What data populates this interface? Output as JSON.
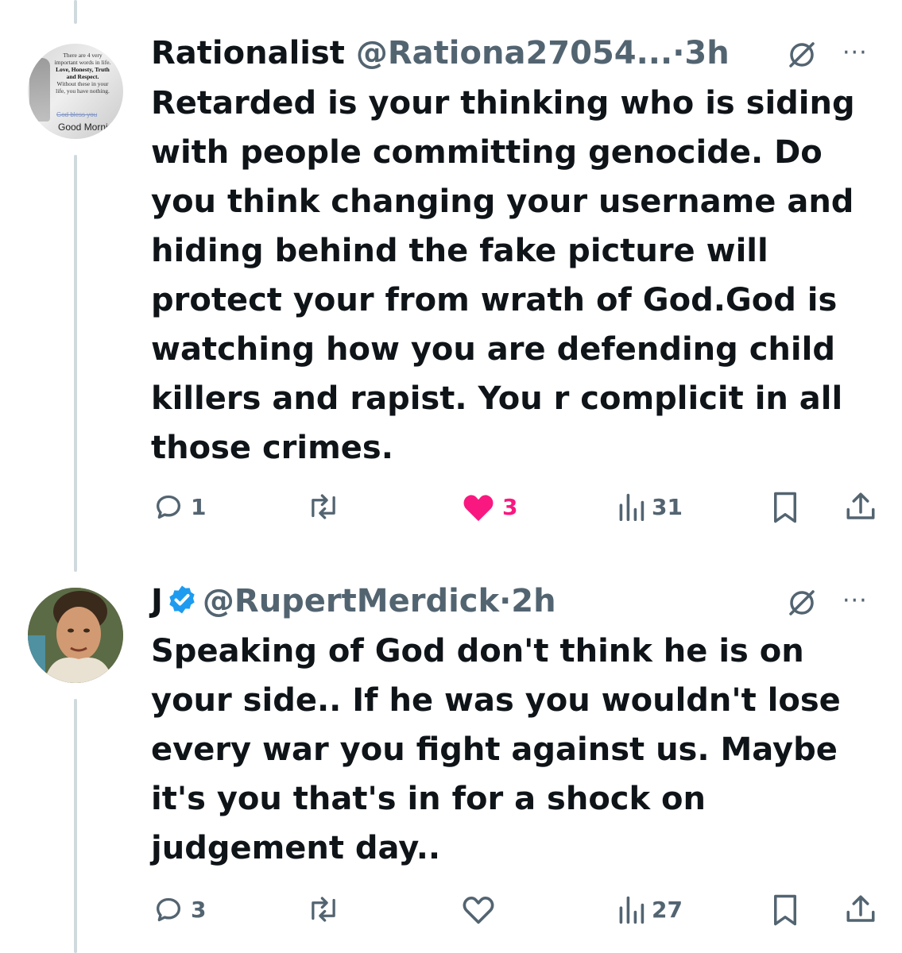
{
  "tweets": [
    {
      "display_name": "Rationalist",
      "handle": "@Rationa27054...",
      "time": "3h",
      "avatar_text": {
        "quote_line1": "There are 4 very",
        "quote_line2": "important words in life.",
        "quote_line3": "Love, Honesty, Truth",
        "quote_line4": "and Respect.",
        "quote_line5": "Without these in your",
        "quote_line6": "life, you have nothing.",
        "god_bless": "God bless you",
        "greeting": "Good Mornir"
      },
      "text": "Retarded is your thinking who is siding with people committing genocide. Do you think changing your username and hiding behind the fake picture will protect your from wrath of God.God is watching how you are defending child killers and rapist. You r complicit in all those crimes.",
      "replies": "1",
      "reposts": "",
      "likes": "3",
      "liked": true,
      "views": "31"
    },
    {
      "display_name": "J",
      "handle": "@RupertMerdick",
      "time": "2h",
      "verified": true,
      "text": "Speaking of God don't think he is on your side.. If he was you wouldn't lose every war you fight against us. Maybe it's you that's in for a shock on judgement day..",
      "replies": "3",
      "reposts": "",
      "likes": "",
      "liked": false,
      "views": "27"
    }
  ],
  "separator": "·",
  "colors": {
    "text": "#0f1419",
    "secondary": "#536471",
    "like": "#f91880",
    "verified": "#1d9bf0",
    "thread_line": "#cfd9de"
  },
  "icons": [
    "grok-icon",
    "more-icon",
    "reply-icon",
    "repost-icon",
    "heart-icon",
    "views-icon",
    "bookmark-icon",
    "share-icon",
    "verified-icon"
  ]
}
